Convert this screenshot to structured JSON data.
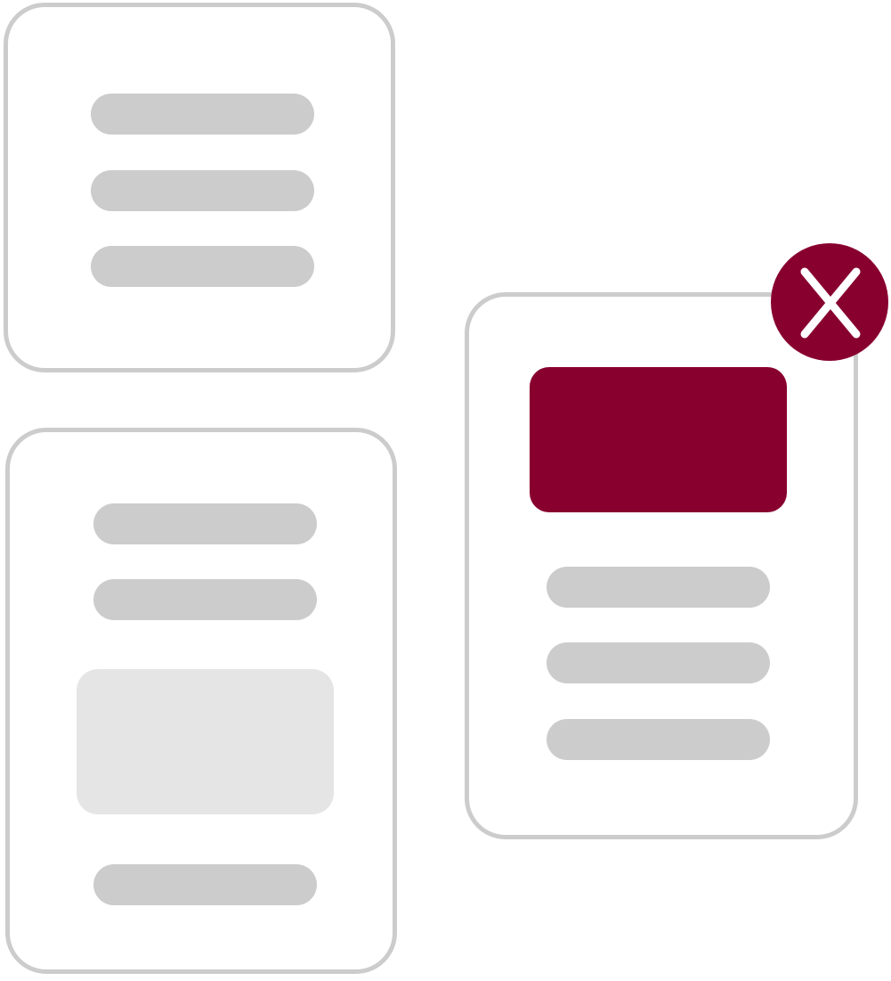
{
  "colors": {
    "card_border": "#cccccc",
    "placeholder_line": "#cccccc",
    "placeholder_block": "#e5e5e5",
    "accent": "#88002e",
    "badge_mark": "#ffffff"
  },
  "cards": [
    {
      "name": "card-top-left",
      "content": [
        "line",
        "line",
        "line"
      ]
    },
    {
      "name": "card-bottom-left",
      "content": [
        "line",
        "line",
        "image-block",
        "line"
      ]
    },
    {
      "name": "card-rejected",
      "content": [
        "image-block",
        "line",
        "line",
        "line"
      ],
      "status": "rejected"
    }
  ],
  "badge": {
    "icon": "close-icon",
    "meaning": "rejected"
  }
}
